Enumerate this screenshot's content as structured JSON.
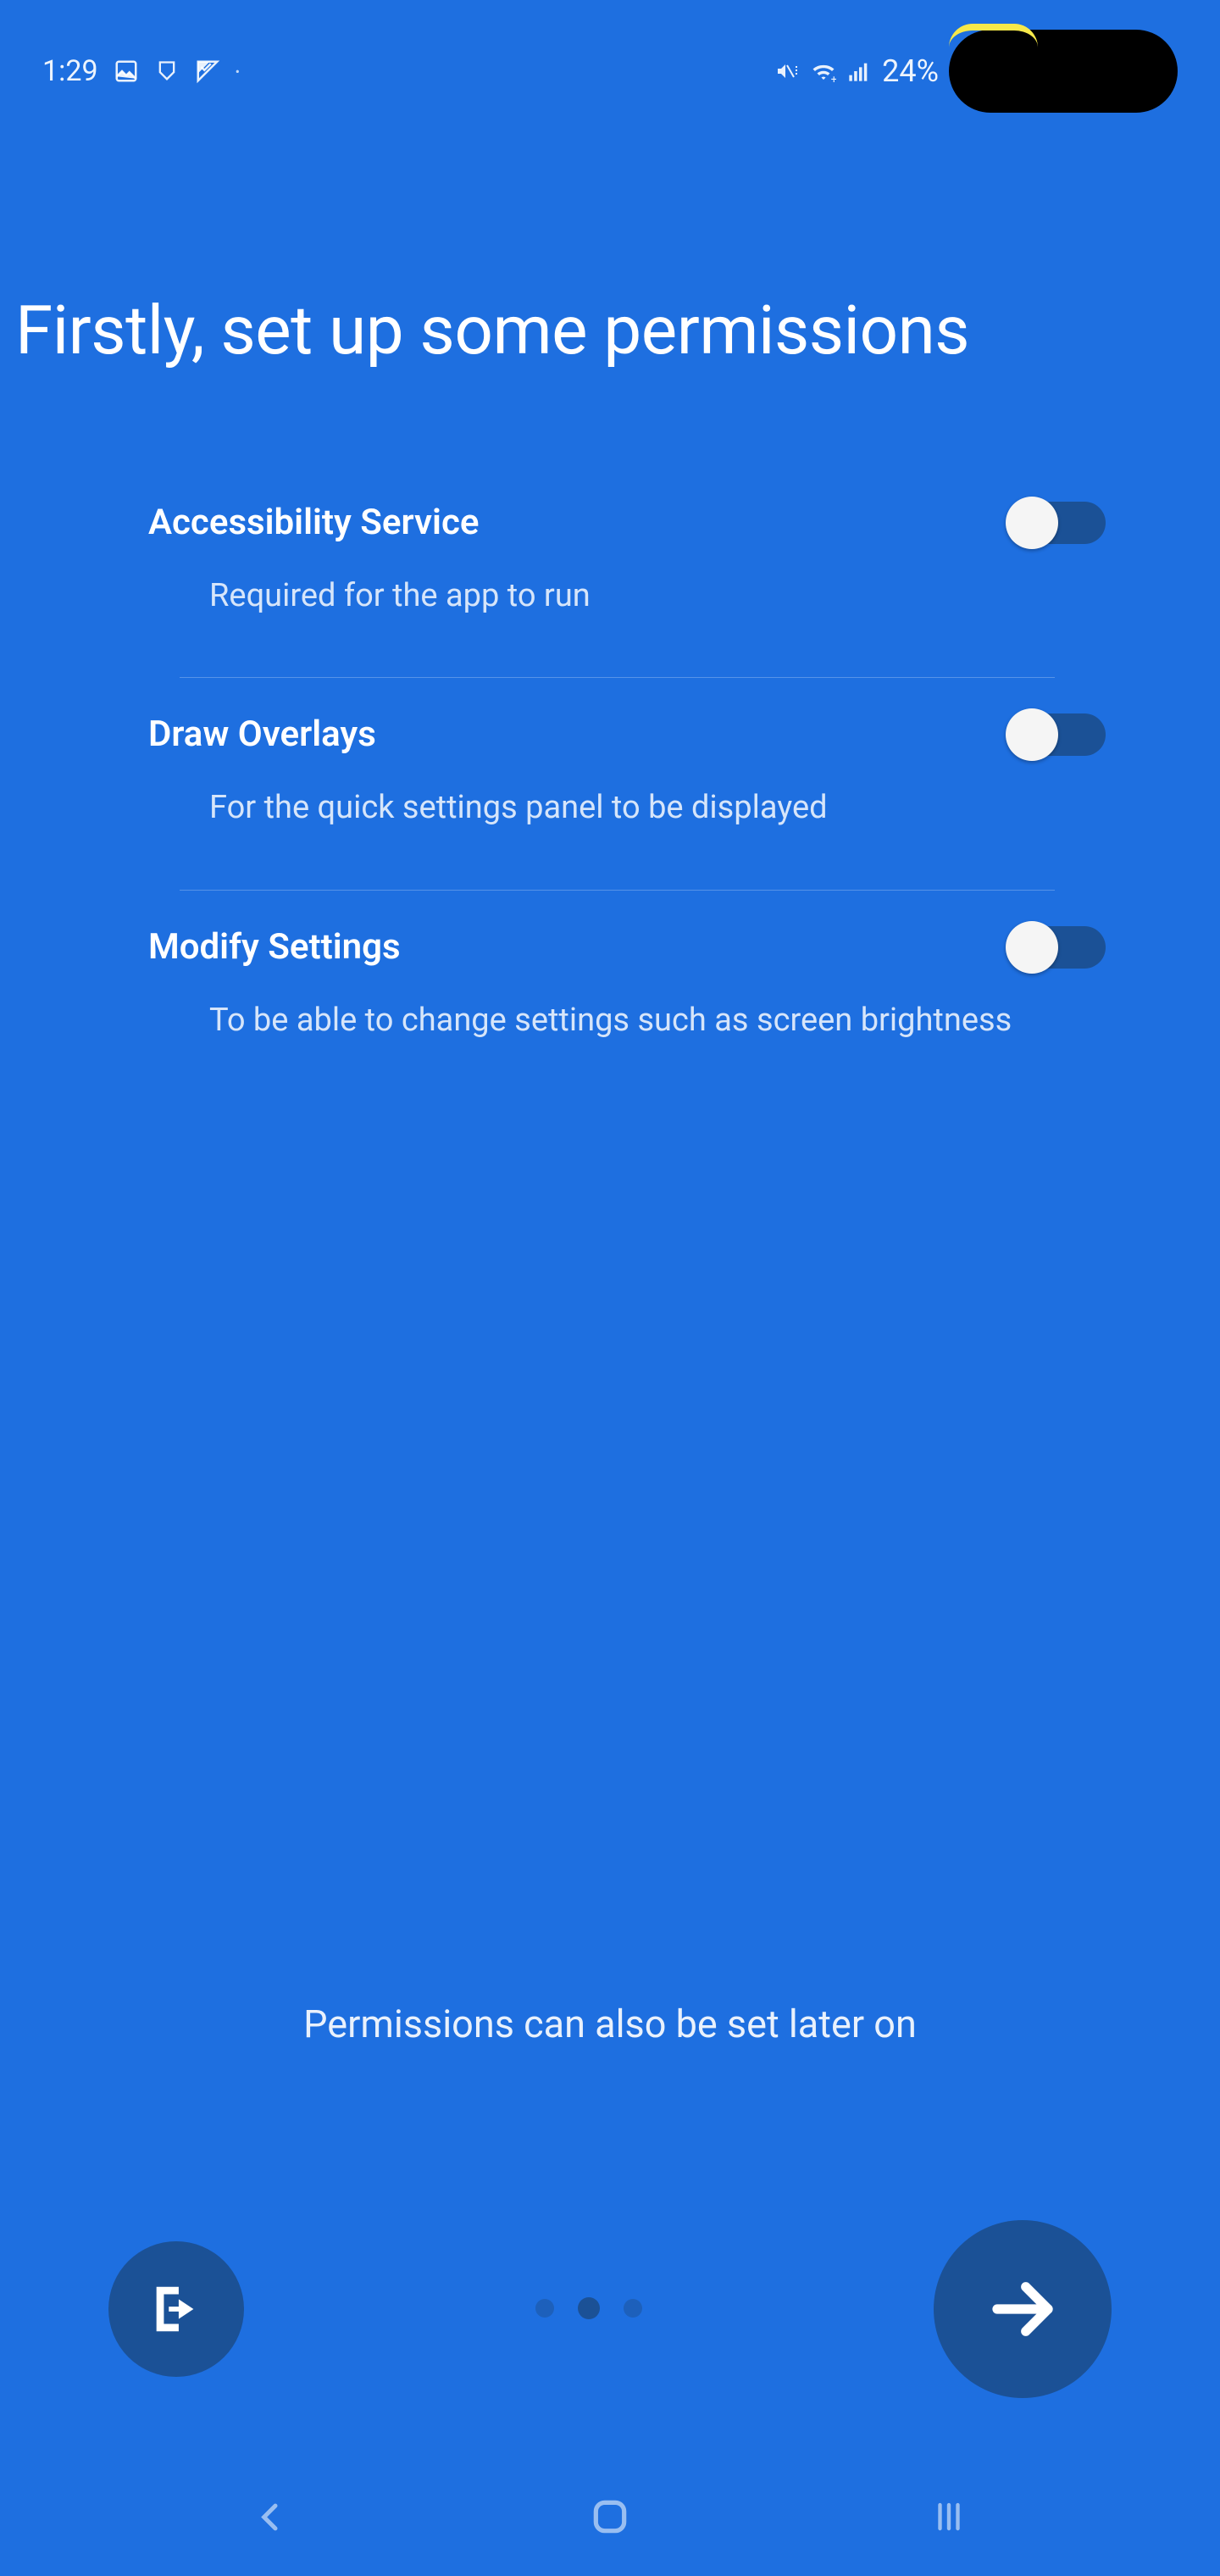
{
  "status_bar": {
    "time": "1:29",
    "battery": "24%"
  },
  "page": {
    "title": "Firstly, set up some permissions",
    "bottom_note": "Permissions can also be set later on"
  },
  "permissions": [
    {
      "title": "Accessibility Service",
      "description": "Required for the app to run",
      "enabled": false
    },
    {
      "title": "Draw Overlays",
      "description": "For the quick settings panel to be displayed",
      "enabled": false
    },
    {
      "title": "Modify Settings",
      "description": "To be able to change settings such as screen brightness",
      "enabled": false
    }
  ]
}
